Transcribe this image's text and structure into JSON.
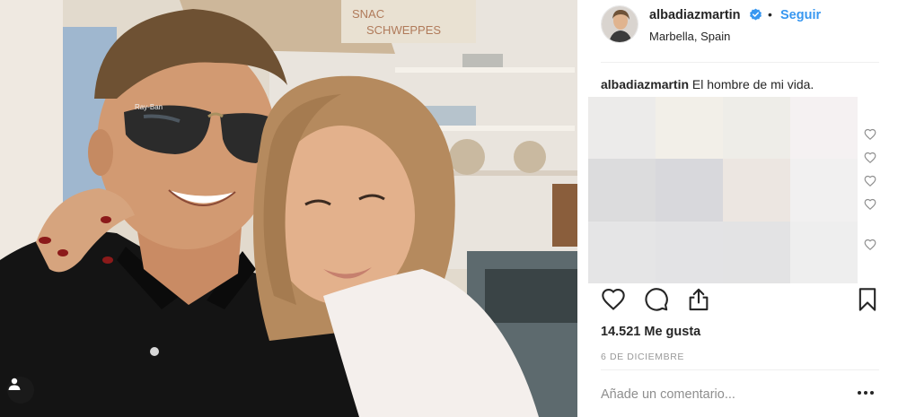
{
  "post": {
    "username": "albadiazmartin",
    "follow_label": "Seguir",
    "separator": "•",
    "location": "Marbella, Spain",
    "caption_user": "albadiazmartin",
    "caption_text": " El hombre de mi vida.",
    "likes": "14.521 Me gusta",
    "date": "6 DE DICIEMBRE",
    "comment_placeholder": "Añade un comentario...",
    "more_options": "•••"
  },
  "photo": {
    "sign_text_1": "SNAC",
    "sign_text_2": "SCHWEPPES",
    "glasses_brand": "Ray-Ban"
  },
  "icons": {
    "verified": "verified-badge-icon",
    "like": "heart-icon",
    "comment": "comment-bubble-icon",
    "share": "share-icon",
    "save": "bookmark-icon",
    "tag": "user-tag-icon",
    "more": "more-dots-icon"
  },
  "colors": {
    "link_blue": "#3897f0",
    "text_dark": "#262626",
    "text_muted": "#999999",
    "placeholder": "#8e8e8e",
    "divider": "#efefef"
  }
}
